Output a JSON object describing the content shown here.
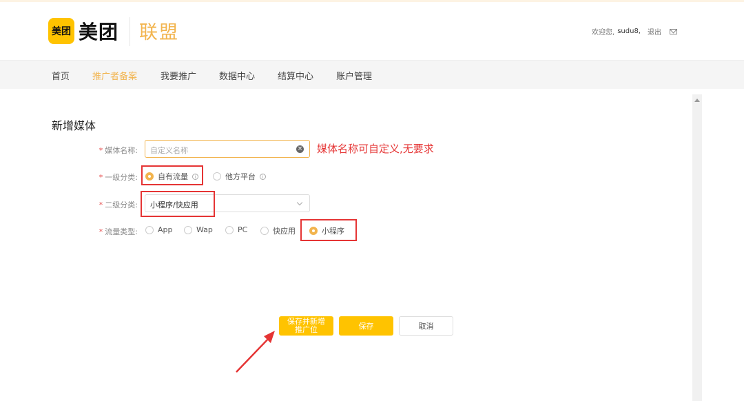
{
  "header": {
    "logo_badge": "美团",
    "logo_text": "美团",
    "logo_sub": "联盟",
    "user": {
      "welcome": "欢迎您,",
      "username": "sudu8,",
      "logout": "退出"
    }
  },
  "nav": {
    "items": [
      "首页",
      "推广者备案",
      "我要推广",
      "数据中心",
      "结算中心",
      "账户管理"
    ],
    "active": "推广者备案"
  },
  "form": {
    "title": "新增媒体",
    "required_mark": "*",
    "name": {
      "label": "媒体名称:",
      "placeholder": "自定义名称"
    },
    "level1": {
      "label": "一级分类:",
      "options": [
        "自有流量",
        "他方平台"
      ],
      "selected": "自有流量"
    },
    "level2": {
      "label": "二级分类:",
      "value": "小程序/快应用"
    },
    "traffic": {
      "label": "流量类型:",
      "options": [
        "App",
        "Wap",
        "PC",
        "快应用",
        "小程序"
      ],
      "selected": "小程序"
    }
  },
  "annotation": {
    "text": "媒体名称可自定义,无要求",
    "color": "#e53434"
  },
  "buttons": {
    "save_and_add_line1": "保存并新增",
    "save_and_add_line2": "推广位",
    "save": "保存",
    "cancel": "取消"
  },
  "colors": {
    "brand_yellow": "#ffc300",
    "accent_orange": "#f2b44e",
    "required_red": "#e54545"
  }
}
